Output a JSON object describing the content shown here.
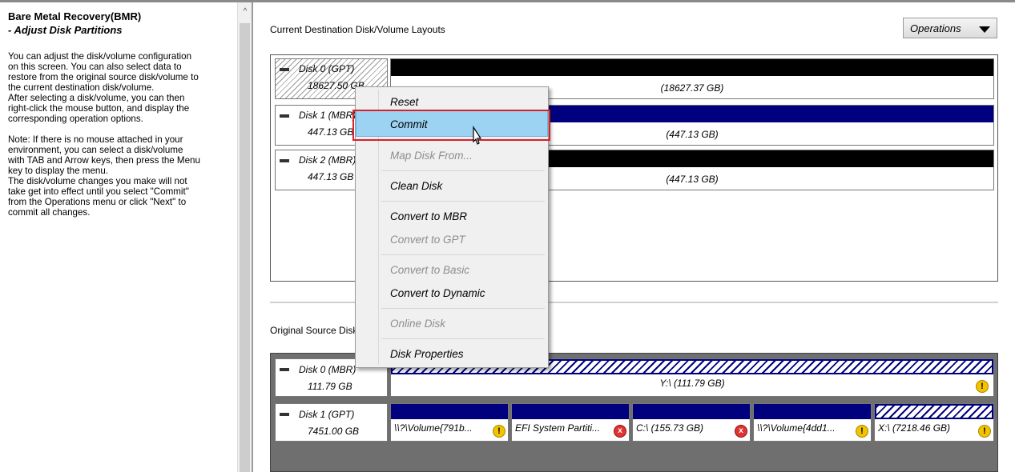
{
  "left_pane": {
    "title": "Bare Metal Recovery(BMR)",
    "subtitle": " - Adjust Disk Partitions",
    "paragraph1": [
      "You can adjust the disk/volume configuration",
      "on this screen. You can also select data to",
      "restore from the original source disk/volume to",
      "the current destination disk/volume.",
      "After selecting a disk/volume, you can then",
      "right-click the mouse button, and display the",
      "corresponding operation options."
    ],
    "paragraph2": [
      "Note: If there is no mouse attached in your",
      "environment, you can select a disk/volume",
      "with TAB and Arrow keys, then press the Menu",
      "key to display the menu.",
      "The disk/volume changes you make will not",
      "take get into effect until you select \"Commit\"",
      "from the Operations menu or click \"Next\" to",
      "commit all changes."
    ],
    "scroll_up_glyph": "^"
  },
  "destination": {
    "label": "Current Destination Disk/Volume Layouts",
    "operations_button": "Operations",
    "disks": [
      {
        "name": "Disk 0 (GPT)",
        "size": "18627.50 GB",
        "volume_size": "(18627.37 GB)"
      },
      {
        "name": "Disk 1 (MBR)",
        "size": "447.13 GB",
        "volume_size": "(447.13 GB)"
      },
      {
        "name": "Disk 2 (MBR)",
        "size": "447.13 GB",
        "volume_size": "(447.13 GB)"
      }
    ]
  },
  "source": {
    "label": "Original Source Disk/Volume Layouts",
    "disks": [
      {
        "name": "Disk 0 (MBR)",
        "size": "111.79 GB",
        "volumes": [
          {
            "label": "Y:\\ (111.79 GB)"
          }
        ]
      },
      {
        "name": "Disk 1 (GPT)",
        "size": "7451.00 GB",
        "volumes": [
          {
            "label": "\\\\?\\Volume{791b..."
          },
          {
            "label": "EFI System Partiti..."
          },
          {
            "label": "C:\\ (155.73 GB)"
          },
          {
            "label": "\\\\?\\Volume{4dd1..."
          },
          {
            "label": "X:\\ (7218.46 GB)"
          }
        ]
      }
    ]
  },
  "context_menu": {
    "items": [
      {
        "label": "Reset",
        "enabled": true
      },
      {
        "label": "Commit",
        "enabled": true,
        "highlighted": true
      },
      {
        "label": "Map Disk From...",
        "enabled": false
      },
      {
        "label": "Clean Disk",
        "enabled": true
      },
      {
        "label": "Convert to MBR",
        "enabled": true
      },
      {
        "label": "Convert to GPT",
        "enabled": false
      },
      {
        "label": "Convert to Basic",
        "enabled": false
      },
      {
        "label": "Convert to Dynamic",
        "enabled": true
      },
      {
        "label": "Online Disk",
        "enabled": false
      },
      {
        "label": "Disk Properties",
        "enabled": true
      }
    ]
  },
  "icons": {
    "warning": "!",
    "error": "x"
  },
  "colors": {
    "volume_blue": "#00007f",
    "highlight": "#9cd3f2",
    "callout_red": "#d8202a",
    "warning_yellow": "#f3c300"
  }
}
